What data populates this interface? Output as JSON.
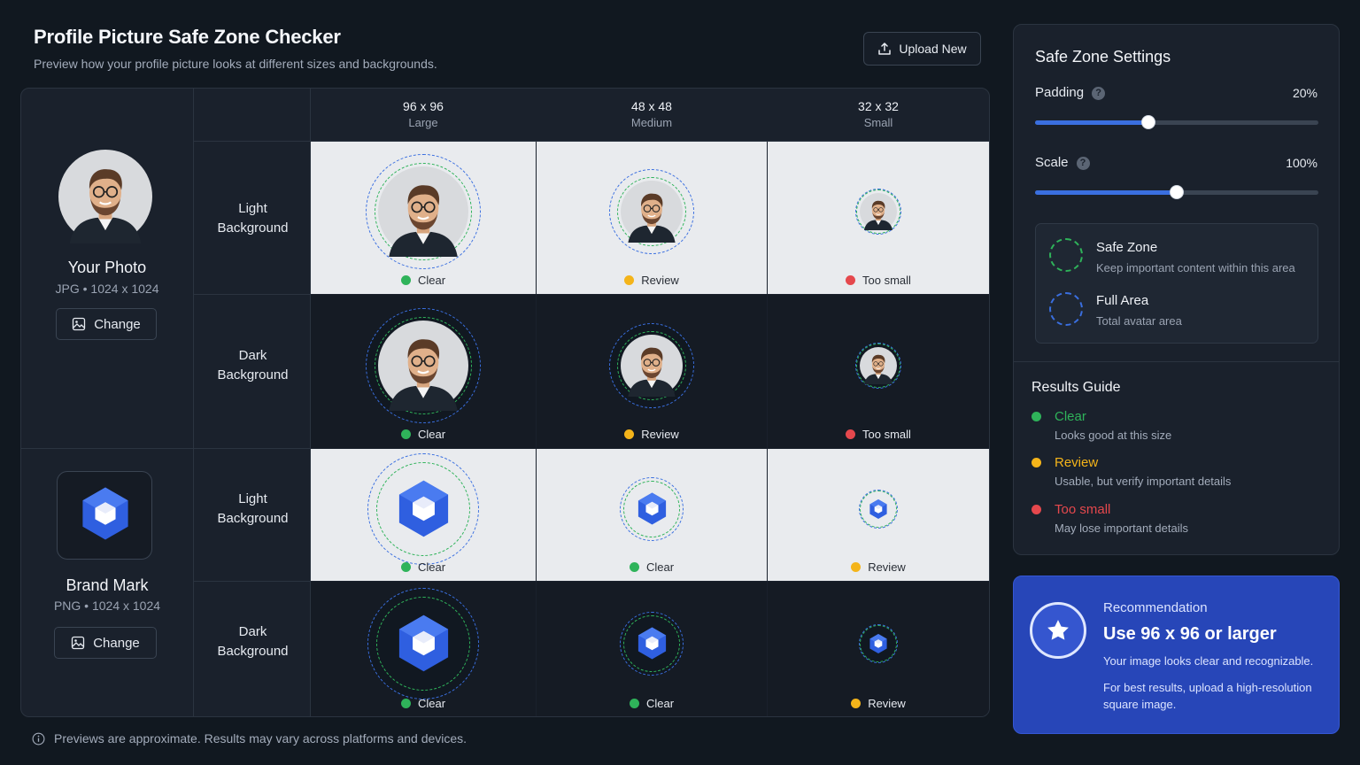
{
  "header": {
    "title": "Profile Picture Safe Zone Checker",
    "subtitle": "Preview how your profile picture looks at different sizes and backgrounds.",
    "upload_label": "Upload New"
  },
  "columns": [
    {
      "size": "96 x 96",
      "label": "Large"
    },
    {
      "size": "48 x 48",
      "label": "Medium"
    },
    {
      "size": "32 x 32",
      "label": "Small"
    }
  ],
  "row_labels": {
    "light_1": "Light",
    "light_2": "Background",
    "dark_1": "Dark",
    "dark_2": "Background"
  },
  "images": [
    {
      "name": "Your Photo",
      "meta": "JPG • 1024 x 1024",
      "change_label": "Change",
      "light": [
        "Clear",
        "Review",
        "Too small"
      ],
      "dark": [
        "Clear",
        "Review",
        "Too small"
      ]
    },
    {
      "name": "Brand Mark",
      "meta": "PNG • 1024 x 1024",
      "change_label": "Change",
      "light": [
        "Clear",
        "Clear",
        "Review"
      ],
      "dark": [
        "Clear",
        "Clear",
        "Review"
      ]
    }
  ],
  "settings": {
    "title": "Safe Zone Settings",
    "padding_label": "Padding",
    "padding_value": "20%",
    "padding_fraction": 0.4,
    "scale_label": "Scale",
    "scale_value": "100%",
    "scale_fraction": 0.5,
    "legend": {
      "safe_title": "Safe Zone",
      "safe_desc": "Keep important content within this area",
      "full_title": "Full Area",
      "full_desc": "Total avatar area"
    }
  },
  "guide": {
    "title": "Results Guide",
    "items": [
      {
        "label": "Clear",
        "desc": "Looks good at this size"
      },
      {
        "label": "Review",
        "desc": "Usable, but verify important details"
      },
      {
        "label": "Too small",
        "desc": "May lose important details"
      }
    ]
  },
  "recommendation": {
    "kicker": "Recommendation",
    "headline": "Use 96 x 96 or larger",
    "line1": "Your image looks clear and recognizable.",
    "line2": "For best results, upload a high-resolution square image."
  },
  "footer": {
    "note": "Previews are approximate. Results may vary across platforms and devices."
  },
  "colors": {
    "clear": "#2fb35a",
    "review": "#f4b41a",
    "too_small": "#e5484d",
    "accent": "#3a6fe0"
  }
}
